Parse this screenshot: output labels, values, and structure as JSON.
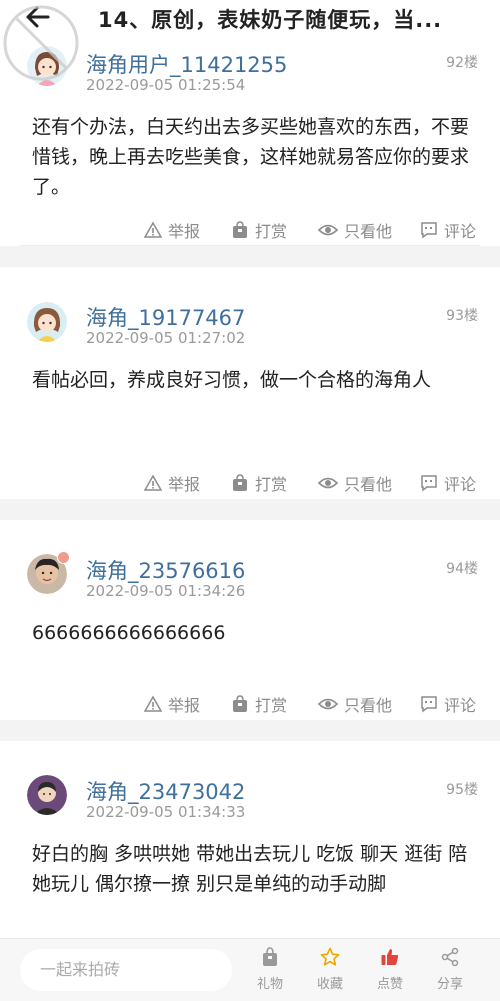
{
  "header": {
    "title": "14、原创，表妹奶子随便玩，当..."
  },
  "posts": [
    {
      "username": "海角用户_11421255",
      "time": "2022-09-05 01:25:54",
      "floor": "92楼",
      "content": "还有个办法，白天约出去多买些她喜欢的东西，不要惜钱，晚上再去吃些美食，这样她就易答应你的要求了。"
    },
    {
      "username": "海角_19177467",
      "time": "2022-09-05 01:27:02",
      "floor": "93楼",
      "content": "看帖必回，养成良好习惯，做一个合格的海角人"
    },
    {
      "username": "海角_23576616",
      "time": "2022-09-05 01:34:26",
      "floor": "94楼",
      "content": "6666666666666666"
    },
    {
      "username": "海角_23473042",
      "time": "2022-09-05 01:34:33",
      "floor": "95楼",
      "content": "好白的胸 多哄哄她 带她出去玩儿 吃饭 聊天 逛街 陪她玩儿 偶尔撩一撩 别只是单纯的动手动脚"
    }
  ],
  "actions": {
    "report": "举报",
    "reward": "打赏",
    "only_him": "只看他",
    "comment": "评论"
  },
  "bottom_bar": {
    "input_placeholder": "一起来拍砖",
    "gift": "礼物",
    "favorite": "收藏",
    "like": "点赞",
    "share": "分享"
  },
  "colors": {
    "username": "#3f6f9c",
    "like_red": "#e0463b",
    "favorite_gold": "#f0a500"
  }
}
